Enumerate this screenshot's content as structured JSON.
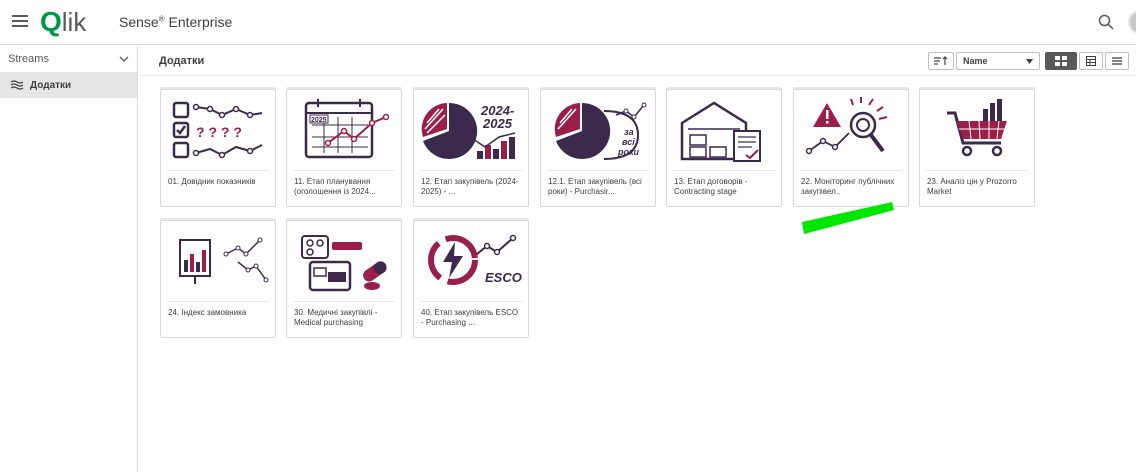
{
  "header": {
    "logo_q": "Q",
    "logo_rest": "lik",
    "app_name": "Sense",
    "app_reg": "®",
    "app_suffix": " Enterprise"
  },
  "sidebar": {
    "streams_label": "Streams",
    "items": [
      {
        "label": "Додатки",
        "selected": true
      }
    ]
  },
  "content": {
    "title": "Додатки",
    "sort_label": "Name",
    "apps": [
      {
        "label": "01. Довідник показників",
        "icon": "checklist-questions-icon"
      },
      {
        "label": "11. Етап планування (оголошення із 2024...",
        "icon": "calendar-2025-icon"
      },
      {
        "label": "12. Етап закупівель (2024-2025) -       ...",
        "icon": "pie-chart-2024-2025-icon"
      },
      {
        "label": "12.1. Етап закупівель (всі роки) - Purchasir...",
        "icon": "pie-chart-all-years-icon"
      },
      {
        "label": "13. Етап договорів - Contracting stage",
        "icon": "warehouse-contract-icon"
      },
      {
        "label": "22. Моніторинг публічних закупівел..",
        "icon": "monitoring-magnifier-icon"
      },
      {
        "label": "23. Аналіз цін у Prozorro Market",
        "icon": "shopping-cart-icon"
      },
      {
        "label": "24. Індекс замовника",
        "icon": "customer-index-chart-icon"
      },
      {
        "label": "30. Медичні закупівлі - Medical purchasing",
        "icon": "medical-pills-icon"
      },
      {
        "label": "40. Етап закупівель ESCO - Purchasing   ...",
        "icon": "esco-energy-icon"
      }
    ],
    "thumb_texts": {
      "calendar_year": "2025",
      "years": "2024-",
      "years2": "2025",
      "all_years_1": "за",
      "all_years_2": "всі",
      "all_years_3": "роки",
      "esco": "ESCO",
      "questions": "? ? ? ?"
    }
  },
  "colors": {
    "accent": "#9a1f4a",
    "brand_green": "#009845",
    "annotation_green": "#00e600"
  }
}
